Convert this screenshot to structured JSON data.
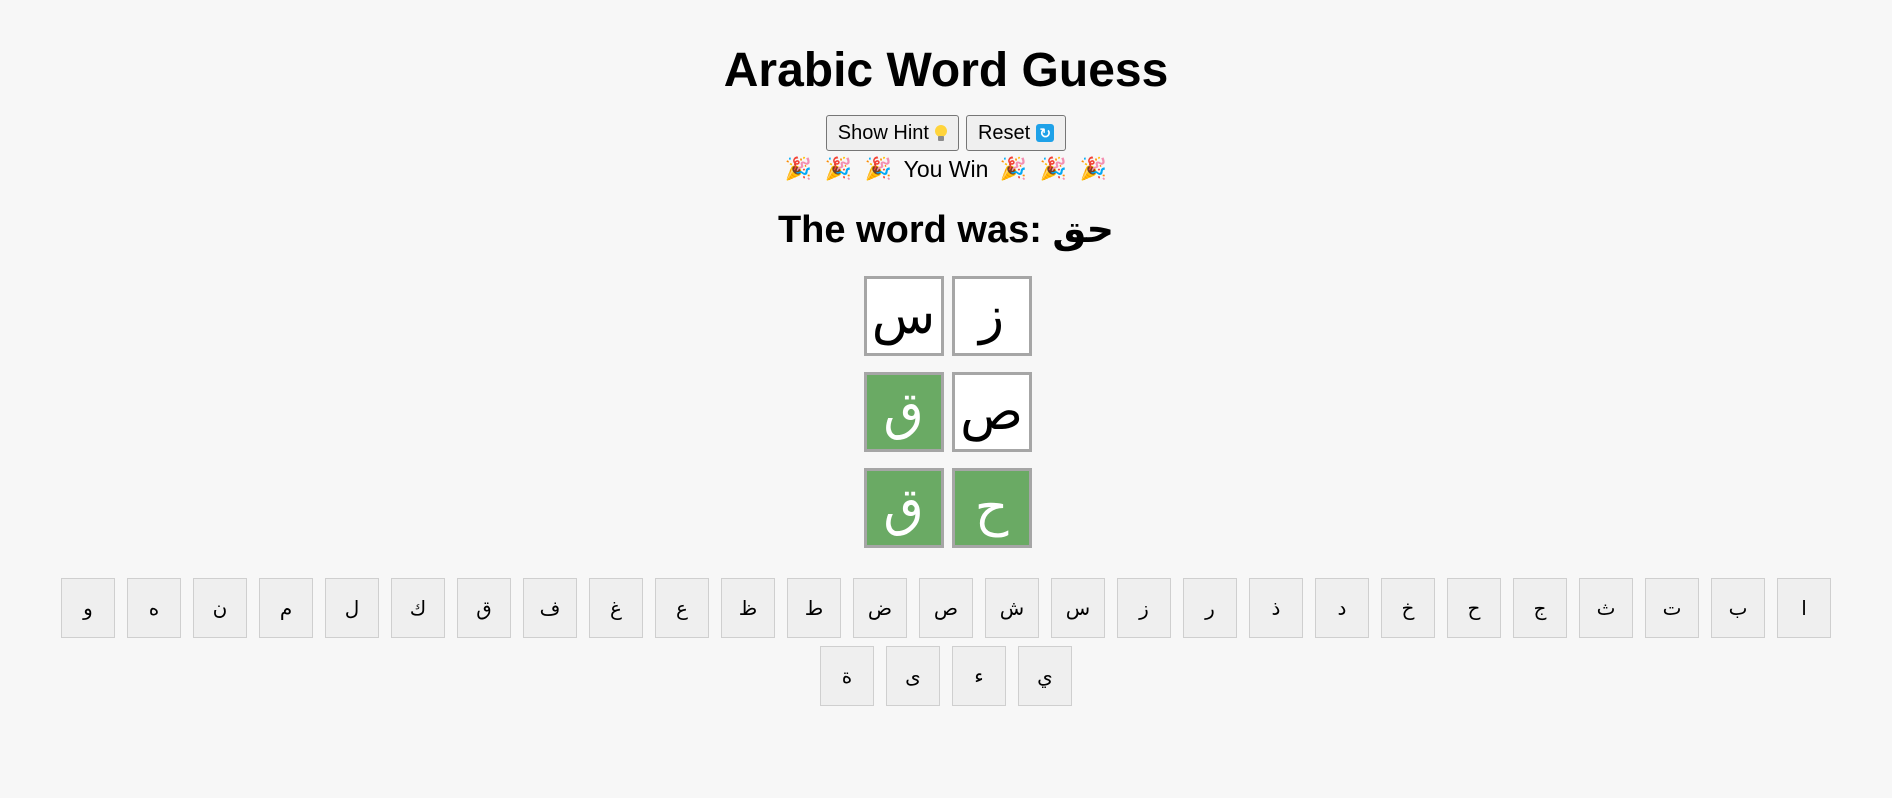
{
  "title": "Arabic Word Guess",
  "controls": {
    "hint_label": "Show Hint",
    "reset_label": "Reset"
  },
  "status": {
    "message": "You Win",
    "party_glyph": "🎉"
  },
  "answer": {
    "text": "The word was: حق"
  },
  "board": {
    "rows": [
      [
        {
          "letter": "ز",
          "state": "absent"
        },
        {
          "letter": "س",
          "state": "absent"
        }
      ],
      [
        {
          "letter": "ص",
          "state": "absent"
        },
        {
          "letter": "ق",
          "state": "correct"
        }
      ],
      [
        {
          "letter": "ح",
          "state": "correct"
        },
        {
          "letter": "ق",
          "state": "correct"
        }
      ]
    ]
  },
  "colors": {
    "correct": "#6aaa64",
    "tile_border": "#a6a6a6",
    "reset_icon": "#1ea1e8"
  },
  "keyboard": {
    "keys": [
      "ا",
      "ب",
      "ت",
      "ث",
      "ج",
      "ح",
      "خ",
      "د",
      "ذ",
      "ر",
      "ز",
      "س",
      "ش",
      "ص",
      "ض",
      "ط",
      "ظ",
      "ع",
      "غ",
      "ف",
      "ق",
      "ك",
      "ل",
      "م",
      "ن",
      "ه",
      "و",
      "ي",
      "ء",
      "ى",
      "ة"
    ]
  },
  "icons": {
    "hint": "lightbulb-icon",
    "reset": "refresh-icon",
    "party": "party-popper-icon"
  }
}
